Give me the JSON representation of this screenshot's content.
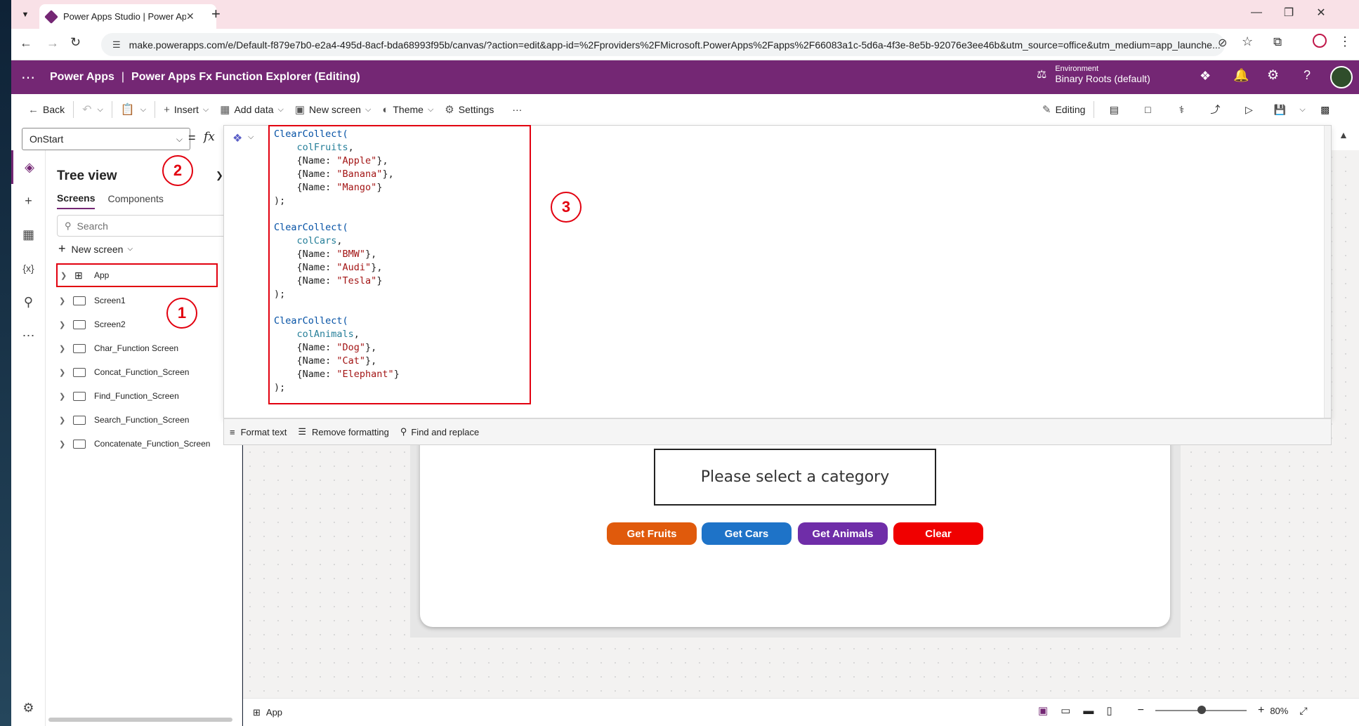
{
  "browser": {
    "tab_title": "Power Apps Studio | Power Apps",
    "new_tab": "+",
    "url": "make.powerapps.com/e/Default-f879e7b0-e2a4-495d-8acf-bda68993f95b/canvas/?action=edit&app-id=%2Fproviders%2FMicrosoft.PowerApps%2Fapps%2F66083a1c-5d6a-4f3e-8e5b-92076e3ee46b&utm_source=office&utm_medium=app_launche..."
  },
  "header": {
    "product": "Power Apps",
    "separator": "|",
    "app_name": "Power Apps Fx Function Explorer (Editing)",
    "env_label": "Environment",
    "env_name": "Binary Roots (default)"
  },
  "toolbar": {
    "back": "Back",
    "insert": "Insert",
    "add_data": "Add data",
    "new_screen": "New screen",
    "theme": "Theme",
    "settings": "Settings",
    "more": "···",
    "editing": "Editing"
  },
  "formula": {
    "property": "OnStart",
    "equals": "=",
    "fx": "fx"
  },
  "tree": {
    "title": "Tree view",
    "tab_screens": "Screens",
    "tab_components": "Components",
    "search_placeholder": "Search",
    "new_screen": "New screen",
    "items": [
      {
        "label": "App"
      },
      {
        "label": "Screen1"
      },
      {
        "label": "Screen2"
      },
      {
        "label": "Char_Function Screen"
      },
      {
        "label": "Concat_Function_Screen"
      },
      {
        "label": "Find_Function_Screen"
      },
      {
        "label": "Search_Function_Screen"
      },
      {
        "label": "Concatenate_Function_Screen"
      }
    ]
  },
  "code_lines": [
    [
      [
        "fn",
        "ClearCollect("
      ]
    ],
    [
      [
        "pr",
        "    "
      ],
      [
        "id",
        "colFruits"
      ],
      [
        "pr",
        ","
      ]
    ],
    [
      [
        "pr",
        "    {Name: "
      ],
      [
        "str",
        "\"Apple\""
      ],
      [
        "pr",
        "},"
      ]
    ],
    [
      [
        "pr",
        "    {Name: "
      ],
      [
        "str",
        "\"Banana\""
      ],
      [
        "pr",
        "},"
      ]
    ],
    [
      [
        "pr",
        "    {Name: "
      ],
      [
        "str",
        "\"Mango\""
      ],
      [
        "pr",
        "}"
      ]
    ],
    [
      [
        "pr",
        ");"
      ]
    ],
    [
      [
        "pr",
        ""
      ]
    ],
    [
      [
        "fn",
        "ClearCollect("
      ]
    ],
    [
      [
        "pr",
        "    "
      ],
      [
        "id",
        "colCars"
      ],
      [
        "pr",
        ","
      ]
    ],
    [
      [
        "pr",
        "    {Name: "
      ],
      [
        "str",
        "\"BMW\""
      ],
      [
        "pr",
        "},"
      ]
    ],
    [
      [
        "pr",
        "    {Name: "
      ],
      [
        "str",
        "\"Audi\""
      ],
      [
        "pr",
        "},"
      ]
    ],
    [
      [
        "pr",
        "    {Name: "
      ],
      [
        "str",
        "\"Tesla\""
      ],
      [
        "pr",
        "}"
      ]
    ],
    [
      [
        "pr",
        ");"
      ]
    ],
    [
      [
        "pr",
        ""
      ]
    ],
    [
      [
        "fn",
        "ClearCollect("
      ]
    ],
    [
      [
        "pr",
        "    "
      ],
      [
        "id",
        "colAnimals"
      ],
      [
        "pr",
        ","
      ]
    ],
    [
      [
        "pr",
        "    {Name: "
      ],
      [
        "str",
        "\"Dog\""
      ],
      [
        "pr",
        "},"
      ]
    ],
    [
      [
        "pr",
        "    {Name: "
      ],
      [
        "str",
        "\"Cat\""
      ],
      [
        "pr",
        "},"
      ]
    ],
    [
      [
        "pr",
        "    {Name: "
      ],
      [
        "str",
        "\"Elephant\""
      ],
      [
        "pr",
        "}"
      ]
    ],
    [
      [
        "pr",
        ");"
      ]
    ]
  ],
  "editor_footer": {
    "format_text": "Format text",
    "remove_formatting": "Remove formatting",
    "find_replace": "Find and replace"
  },
  "callouts": {
    "one": "1",
    "two": "2",
    "three": "3"
  },
  "canvas": {
    "label_text": "Please select a category",
    "buttons": [
      {
        "label": "Get Fruits",
        "color": "#e05a0c"
      },
      {
        "label": "Get Cars",
        "color": "#1e73c8"
      },
      {
        "label": "Get Animals",
        "color": "#6f2da8"
      },
      {
        "label": "Clear",
        "color": "#f00000"
      }
    ]
  },
  "status": {
    "selected": "App",
    "zoom": "80%",
    "zoom_level": 0.8,
    "minus": "−",
    "plus": "+"
  },
  "colors": {
    "brand": "#742774",
    "callout": "#e2000f"
  }
}
